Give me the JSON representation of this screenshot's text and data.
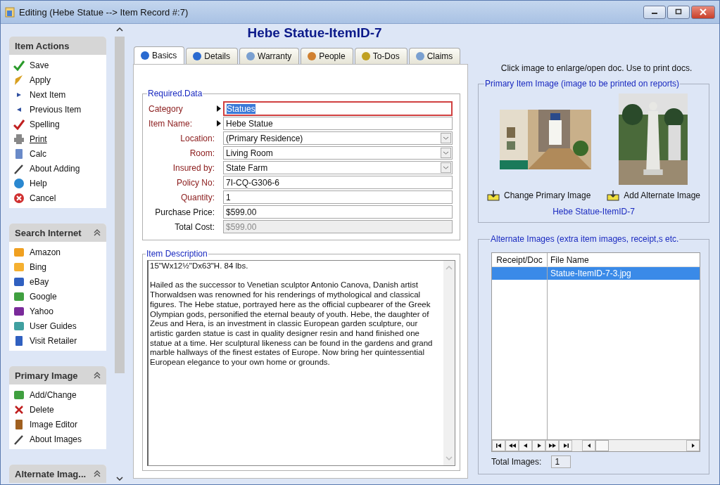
{
  "window": {
    "title": "Editing  (Hebe Statue --> Item Record #:7)"
  },
  "sidebar": {
    "panels": [
      {
        "title": "Item Actions",
        "collapsible": false,
        "items": [
          {
            "label": "Save",
            "hovered": false
          },
          {
            "label": "Apply",
            "hovered": false
          },
          {
            "label": "Next Item",
            "hovered": false
          },
          {
            "label": "Previous Item",
            "hovered": false
          },
          {
            "label": "Spelling",
            "hovered": false
          },
          {
            "label": "Print",
            "hovered": true
          },
          {
            "label": "Calc",
            "hovered": false
          },
          {
            "label": "About Adding",
            "hovered": false
          },
          {
            "label": "Help",
            "hovered": false
          },
          {
            "label": "Cancel",
            "hovered": false
          }
        ]
      },
      {
        "title": "Search Internet",
        "collapsible": true,
        "items": [
          {
            "label": "Amazon",
            "hovered": false
          },
          {
            "label": "Bing",
            "hovered": false
          },
          {
            "label": "eBay",
            "hovered": false
          },
          {
            "label": "Google",
            "hovered": false
          },
          {
            "label": "Yahoo",
            "hovered": false
          },
          {
            "label": "User Guides",
            "hovered": false
          },
          {
            "label": "Visit Retailer",
            "hovered": false
          }
        ]
      },
      {
        "title": "Primary Image",
        "collapsible": true,
        "items": [
          {
            "label": "Add/Change",
            "hovered": false
          },
          {
            "label": "Delete",
            "hovered": false
          },
          {
            "label": "Image Editor",
            "hovered": false
          },
          {
            "label": "About Images",
            "hovered": false
          }
        ]
      },
      {
        "title": "Alternate Imag...",
        "collapsible": true
      }
    ]
  },
  "heading": "Hebe Statue-ItemID-7",
  "tabs": [
    {
      "label": "Basics",
      "selected": true
    },
    {
      "label": "Details",
      "selected": false
    },
    {
      "label": "Warranty",
      "selected": false
    },
    {
      "label": "People",
      "selected": false
    },
    {
      "label": "To-Dos",
      "selected": false
    },
    {
      "label": "Claims",
      "selected": false
    }
  ],
  "required_data": {
    "legend": "Required.Data",
    "fields": [
      {
        "label": "Category",
        "kind": "text",
        "value": "Statues",
        "required": true,
        "pointer": true,
        "focused": true,
        "disabled": false
      },
      {
        "label": "Item Name:",
        "kind": "text",
        "value": "Hebe Statue",
        "required": true,
        "pointer": true,
        "focused": false,
        "disabled": false
      },
      {
        "label": "Location:",
        "kind": "dropdown",
        "value": "(Primary Residence)",
        "required": true,
        "pointer": false,
        "focused": false,
        "disabled": false
      },
      {
        "label": "Room:",
        "kind": "dropdown",
        "value": "Living Room",
        "required": true,
        "pointer": false,
        "focused": false,
        "disabled": false
      },
      {
        "label": "Insured by:",
        "kind": "dropdown",
        "value": "State Farm",
        "required": true,
        "pointer": false,
        "focused": false,
        "disabled": false
      },
      {
        "label": "Policy No:",
        "kind": "text",
        "value": "7I-CQ-G306-6",
        "required": true,
        "pointer": false,
        "focused": false,
        "disabled": false
      },
      {
        "label": "Quantity:",
        "kind": "text",
        "value": "1",
        "required": true,
        "pointer": false,
        "focused": false,
        "disabled": false
      },
      {
        "label": "Purchase Price:",
        "kind": "text",
        "value": "$599.00",
        "required": false,
        "pointer": false,
        "focused": false,
        "disabled": false
      },
      {
        "label": "Total Cost:",
        "kind": "text",
        "value": "$599.00",
        "required": false,
        "pointer": false,
        "focused": false,
        "disabled": true
      }
    ]
  },
  "description": {
    "legend": "Item Description",
    "value": "15\"Wx12½\"Dx63\"H. 84 lbs.\n\nHailed as the successor to Venetian sculptor Antonio Canova, Danish artist Thorwaldsen was renowned for his renderings of mythological and classical figures. The Hebe statue, portrayed here as the official cupbearer of the Greek Olympian gods, personified the eternal beauty of youth. Hebe, the daughter of Zeus and Hera, is an investment in classic European garden sculpture, our artistic garden statue is cast in quality designer resin and hand finished one statue at a time. Her sculptural likeness can be found in the gardens and grand marble hallways of the finest estates of Europe. Now bring her quintessential European elegance to your own home or grounds."
  },
  "hint": "Click image to enlarge/open doc. Use to print docs.",
  "primary_image": {
    "legend": "Primary Item Image (image to be printed on reports)",
    "buttons": [
      "Change Primary Image",
      "Add Alternate Image"
    ],
    "caption": "Hebe Statue-ItemID-7"
  },
  "alternate_images": {
    "legend": "Alternate Images (extra item images, receipt,s etc.",
    "columns": [
      "Receipt/Doc",
      "File Name"
    ],
    "rows": [
      {
        "file_name": "Statue-ItemID-7-3.jpg",
        "selected": true
      }
    ],
    "total_label": "Total Images:",
    "total": "1"
  }
}
